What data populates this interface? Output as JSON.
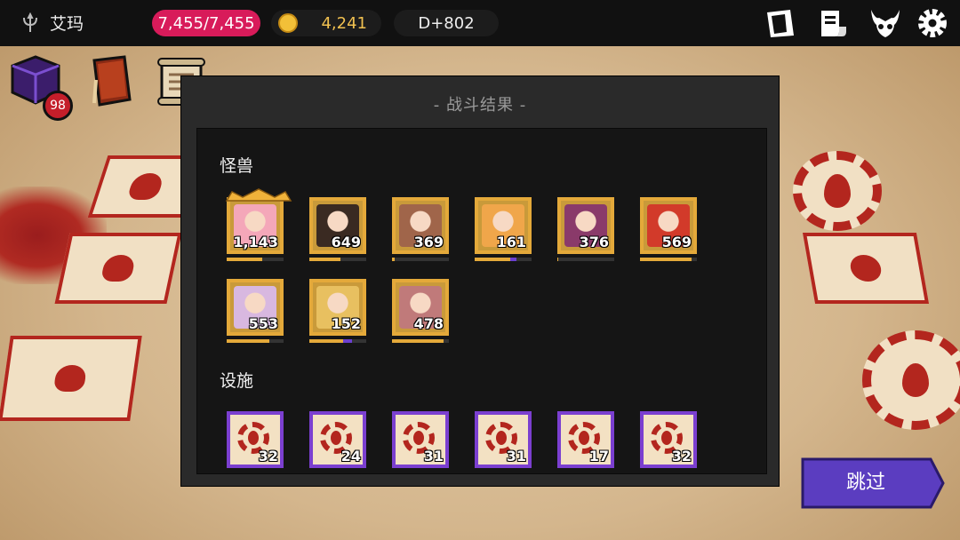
{
  "player": {
    "name": "艾玛"
  },
  "status": {
    "hp": "7,455/7,455",
    "gold": "4,241",
    "day": "D+802"
  },
  "left_icons": {
    "box_badge": "98"
  },
  "dialog": {
    "title": "- 战斗结果 -",
    "monsters_title": "怪兽",
    "facilities_title": "设施",
    "monsters": [
      {
        "value": "1,143",
        "color": "#f4a7b9",
        "xp_fraction": 0.62,
        "bonus_fraction": 0.0,
        "crowned": true
      },
      {
        "value": "649",
        "color": "#3a2a22",
        "xp_fraction": 0.55,
        "bonus_fraction": 0.0,
        "crowned": false
      },
      {
        "value": "369",
        "color": "#a0654a",
        "xp_fraction": 0.04,
        "bonus_fraction": 0.0,
        "crowned": false
      },
      {
        "value": "161",
        "color": "#f0a64a",
        "xp_fraction": 0.62,
        "bonus_fraction": 0.12,
        "crowned": false
      },
      {
        "value": "376",
        "color": "#8a3a6a",
        "xp_fraction": 0.02,
        "bonus_fraction": 0.0,
        "crowned": false
      },
      {
        "value": "569",
        "color": "#d23a2a",
        "xp_fraction": 0.9,
        "bonus_fraction": 0.0,
        "crowned": false
      },
      {
        "value": "553",
        "color": "#d8b8e0",
        "xp_fraction": 0.75,
        "bonus_fraction": 0.0,
        "crowned": false
      },
      {
        "value": "152",
        "color": "#e8c060",
        "xp_fraction": 0.6,
        "bonus_fraction": 0.15,
        "crowned": false
      },
      {
        "value": "478",
        "color": "#c07a7a",
        "xp_fraction": 0.9,
        "bonus_fraction": 0.0,
        "crowned": false
      }
    ],
    "facilities": [
      {
        "value": "32"
      },
      {
        "value": "24"
      },
      {
        "value": "31"
      },
      {
        "value": "31"
      },
      {
        "value": "17"
      },
      {
        "value": "32"
      }
    ]
  },
  "skip_button": {
    "label": "跳过"
  },
  "colors": {
    "accent_purple": "#5b3dc0",
    "hp_pink": "#d81b5a",
    "gold": "#f0c050",
    "card_border": "#e4a93a"
  }
}
